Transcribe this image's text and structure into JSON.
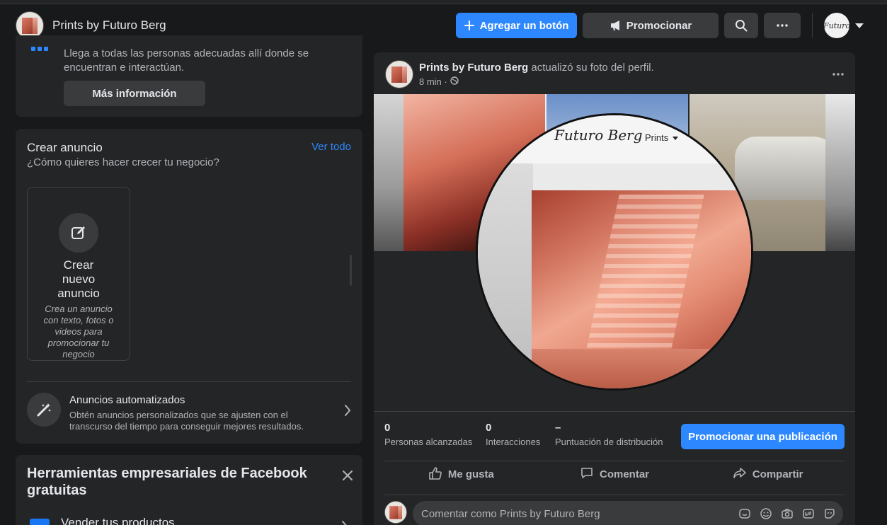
{
  "header": {
    "page_name": "Prints by Futuro Berg",
    "add_button": "Agregar un botón",
    "promote_button": "Promocionar",
    "account_avatar_text": "Futuro"
  },
  "reach_card": {
    "description": "Llega a todas las personas adecuadas allí donde se encuentran e interactúan.",
    "more_info": "Más información"
  },
  "create_ad": {
    "title": "Crear anuncio",
    "see_all": "Ver todo",
    "subtitle": "¿Cómo quieres hacer crecer tu negocio?",
    "tile_title": "Crear nuevo anuncio",
    "tile_desc": "Crea un anuncio con texto, fotos o videos para promocionar tu negocio",
    "auto_title": "Anuncios automatizados",
    "auto_desc": "Obtén anuncios personalizados que se ajusten con el transcurso del tiempo para conseguir mejores resultados."
  },
  "tools": {
    "title": "Herramientas empresariales de Facebook gratuitas",
    "row_label": "Vender tus productos"
  },
  "post": {
    "author": "Prints by Futuro Berg",
    "action_text": "actualizó su foto del perfil.",
    "time": "8 min ·",
    "logo_text": "Futuro Berg",
    "site_menu": "Prints",
    "stats": [
      {
        "value": "0",
        "label": "Personas alcanzadas"
      },
      {
        "value": "0",
        "label": "Interacciones"
      },
      {
        "value": "–",
        "label": "Puntuación de distribución"
      }
    ],
    "promote_post": "Promocionar una publicación",
    "like": "Me gusta",
    "comment": "Comentar",
    "share": "Compartir",
    "comment_placeholder": "Comentar como Prints by Futuro Berg"
  },
  "colors": {
    "accent": "#2d88ff",
    "background": "#18191a",
    "card": "#242526",
    "button_grey": "#3a3b3c"
  },
  "icons": [
    "plus-icon",
    "megaphone-icon",
    "search-icon",
    "more-icon",
    "caret-down-icon",
    "apps-icon",
    "edit-icon",
    "magic-wand-icon",
    "chevron-right-icon",
    "close-icon",
    "globe-icon",
    "like-icon",
    "comment-icon",
    "share-icon",
    "sticker-icon",
    "emoji-icon",
    "camera-icon",
    "gif-icon",
    "avatar-sticker-icon"
  ]
}
